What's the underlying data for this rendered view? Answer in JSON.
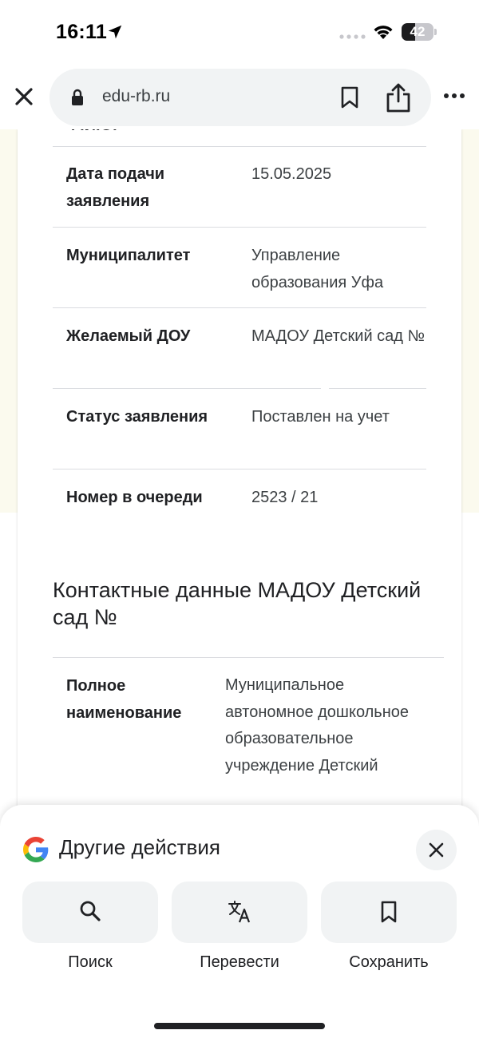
{
  "status_bar": {
    "time": "16:11",
    "battery": "42",
    "battery_level": 0.42
  },
  "browser": {
    "url": "edu-rb.ru",
    "icons": [
      "close-icon",
      "lock-icon",
      "bookmark-icon",
      "share-icon",
      "more-icon"
    ]
  },
  "application": {
    "rows": [
      {
        "label": "Дата подачи заявления",
        "value": "15.05.2025"
      },
      {
        "label": "Муниципалитет",
        "value": "Управление образования Уфа"
      },
      {
        "label": "Желаемый ДОУ",
        "value": "МАДОУ Детский сад №"
      },
      {
        "label": "Статус заявления",
        "value": "Поставлен на учет"
      },
      {
        "label": "Номер в очереди",
        "value": "2523 / 21"
      }
    ]
  },
  "contacts": {
    "title": "Контактные данные МАДОУ Детский сад №",
    "rows": [
      {
        "label": "Полное наименование",
        "value": "Муниципальное автономное дошкольное образовательное учреждение Детский"
      }
    ]
  },
  "bottom_sheet": {
    "title": "Другие действия",
    "actions": [
      {
        "label": "Поиск",
        "icon": "search-icon"
      },
      {
        "label": "Перевести",
        "icon": "translate-icon"
      },
      {
        "label": "Сохранить",
        "icon": "bookmark-icon"
      }
    ]
  },
  "colors": {
    "accent_bg": "#f1f3f4",
    "page_side_bg": "#fbfaee",
    "divider": "#dadce0",
    "text": "#202124"
  }
}
